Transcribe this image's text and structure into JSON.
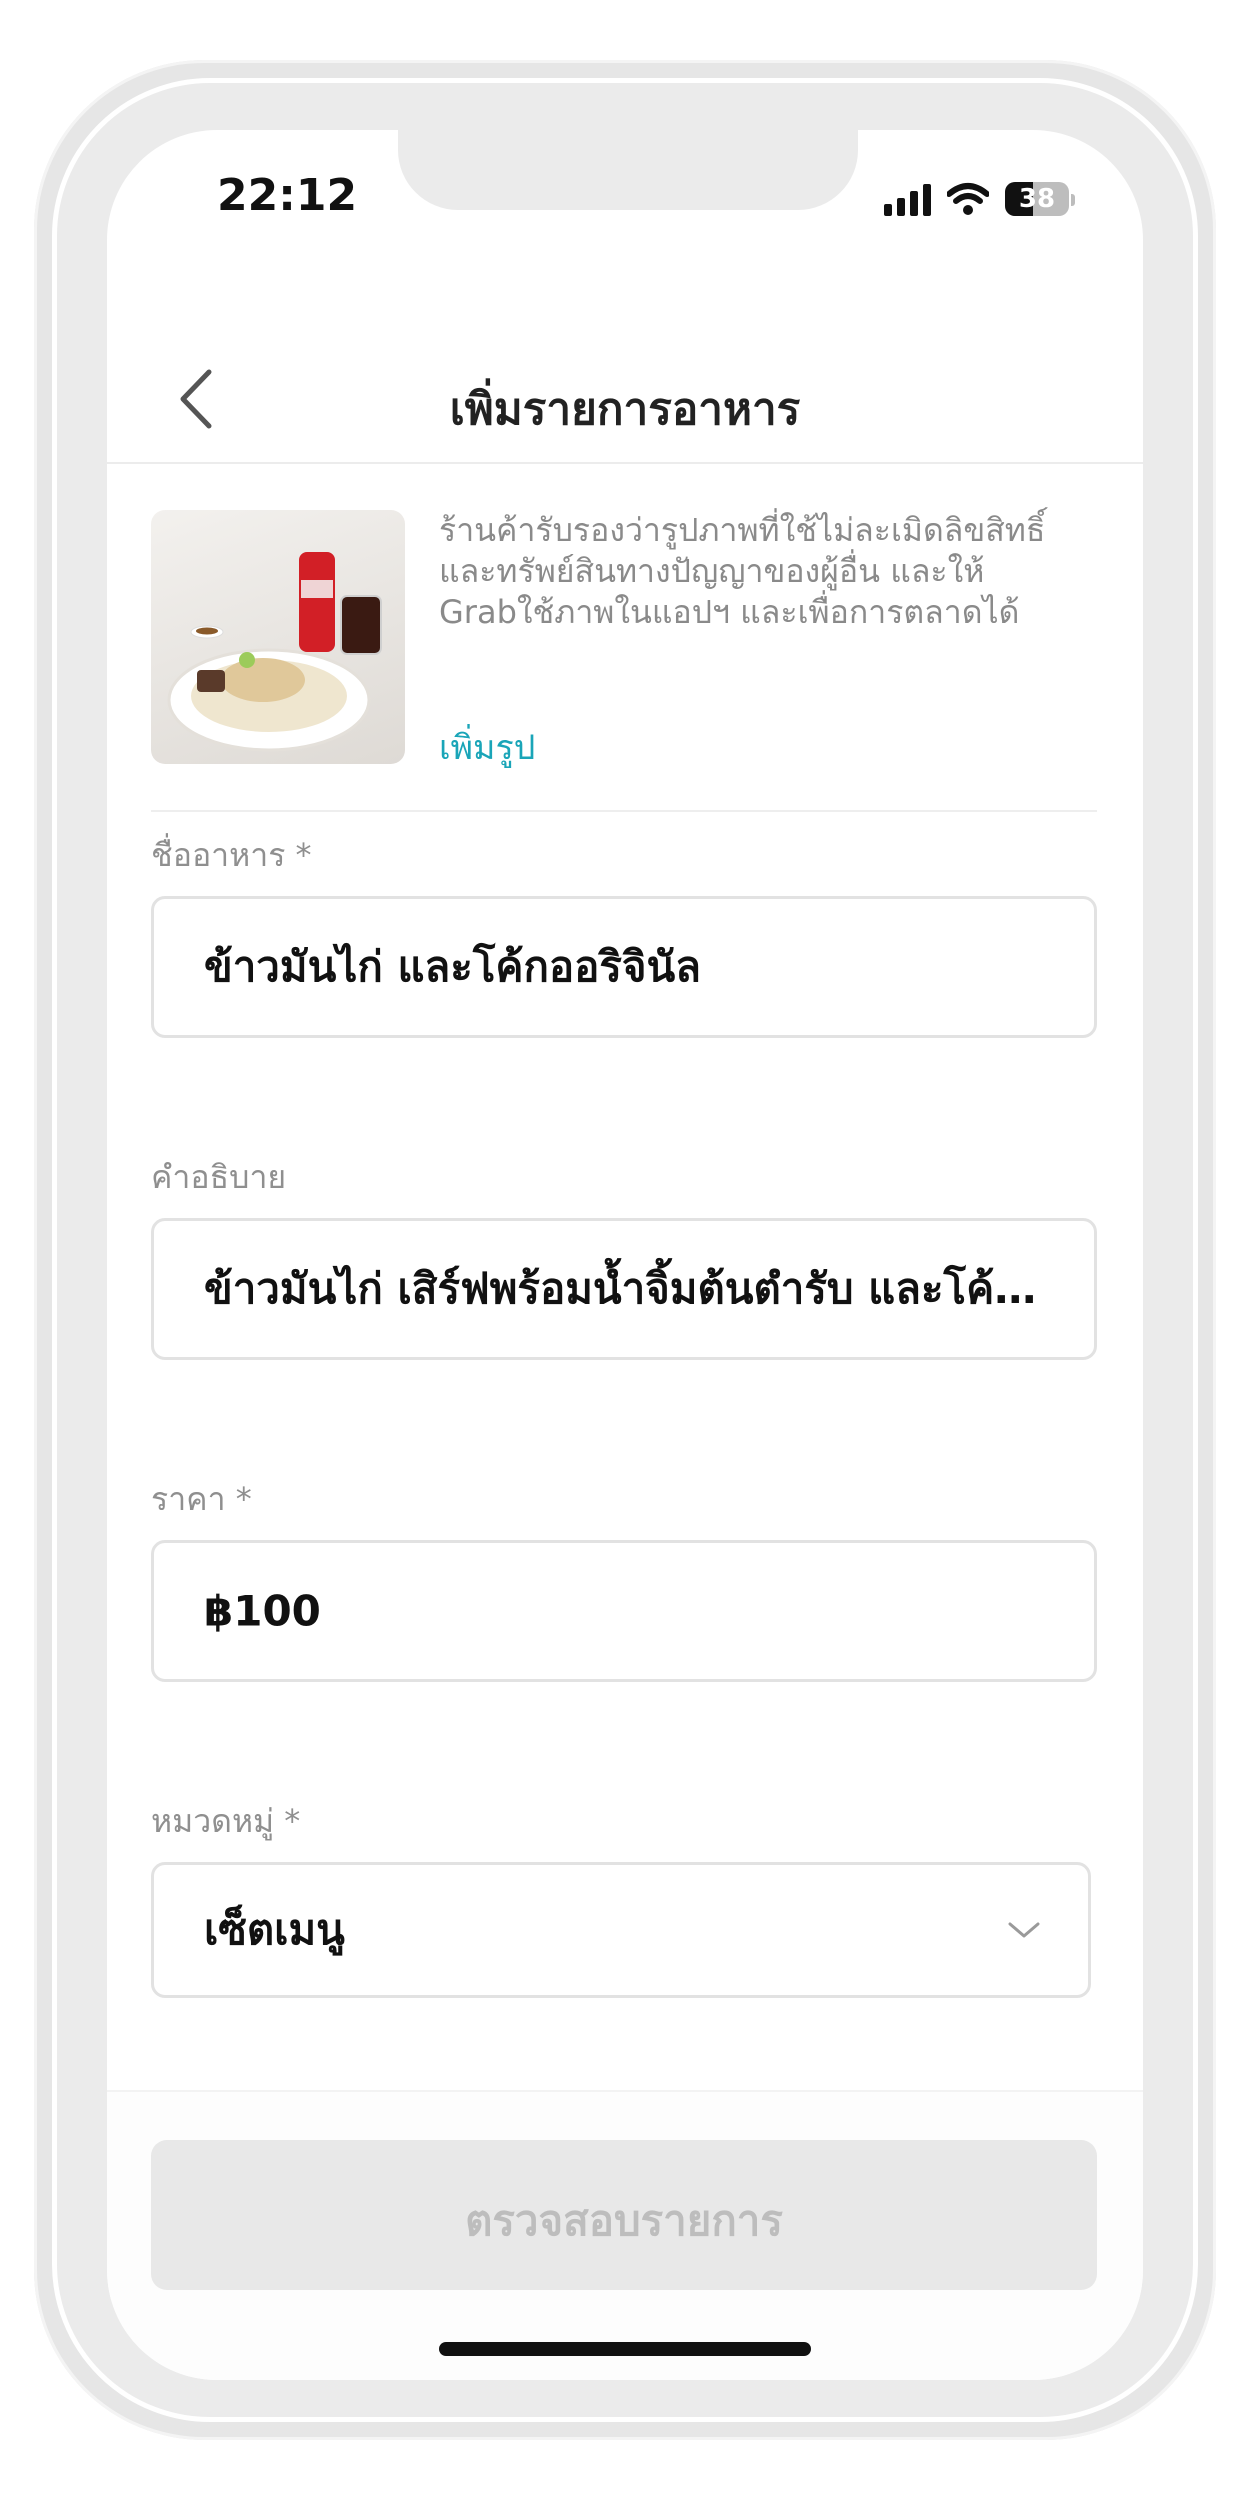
{
  "status_bar": {
    "time": "22:12",
    "battery": "38"
  },
  "header": {
    "title": "เพิ่มรายการอาหาร"
  },
  "photo_section": {
    "disclaimer": [
      "ร้านค้ารับรองว่ารูปภาพที่ใช้ไม่ละเมิดลิขสิทธิ์",
      "และทรัพย์สินทางปัญญาของผู้อื่น และให้",
      "Grabใช้ภาพในแอปฯ และเพื่อการตลาดได้"
    ],
    "add_photo_label": "เพิ่มรูป"
  },
  "form": {
    "name": {
      "label": "ชื่ออาหาร *",
      "value": "ข้าวมันไก่ และโค้กออริจินัล"
    },
    "description": {
      "label": "คำอธิบาย",
      "value": "ข้าวมันไก่ เสิร์ฟพร้อมน้ำจิ้มต้นตำรับ และโค้กออ..."
    },
    "price": {
      "label": "ราคา *",
      "value": "฿100"
    },
    "category": {
      "label": "หมวดหมู่ *",
      "value": "เซ็ตเมนู"
    }
  },
  "submit": {
    "label": "ตรวจสอบรายการ"
  },
  "colors": {
    "accent": "#1aa5b8",
    "disabled_bg": "#e8e8e8",
    "disabled_text": "#bdbdbd"
  }
}
